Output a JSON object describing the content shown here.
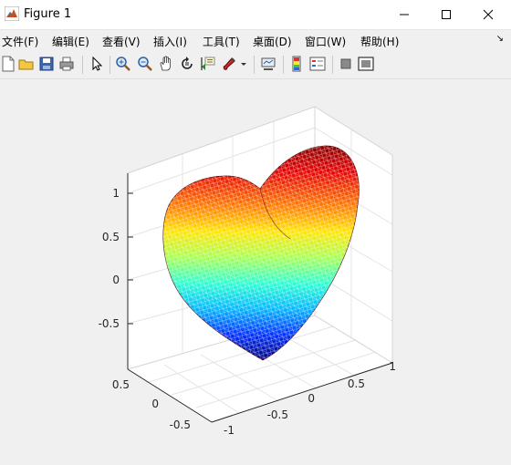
{
  "window": {
    "title": "Figure 1"
  },
  "menu": {
    "items": [
      "文件(F)",
      "编辑(E)",
      "查看(V)",
      "插入(I)",
      "工具(T)",
      "桌面(D)",
      "窗口(W)",
      "帮助(H)"
    ]
  },
  "toolbar": {
    "buttons": [
      "new-figure-icon",
      "open-file-icon",
      "save-icon",
      "print-icon",
      "pointer-icon",
      "zoom-in-icon",
      "zoom-out-icon",
      "pan-hand-icon",
      "rotate-3d-icon",
      "data-cursor-icon",
      "brush-icon",
      "brush-dropdown-icon",
      "link-plot-icon",
      "colorbar-icon",
      "legend-icon",
      "hide-plot-tools-icon",
      "show-plot-tools-icon"
    ]
  },
  "chart_data": {
    "type": "surface-3d",
    "description_shape": "heart",
    "colormap": "jet",
    "render": "wireframe-mesh",
    "z_axis": {
      "ticks": [
        "-0.5",
        "0",
        "0.5",
        "1"
      ],
      "range": [
        -1,
        1.2
      ]
    },
    "y_axis": {
      "ticks": [
        "-0.5",
        "0",
        "0.5"
      ],
      "range": [
        -0.7,
        0.7
      ]
    },
    "x_axis": {
      "ticks": [
        "-1",
        "-0.5",
        "0",
        "0.5",
        "1"
      ],
      "range": [
        -1.2,
        1.2
      ]
    },
    "grid": true,
    "title": "",
    "xlabel": "",
    "ylabel": "",
    "zlabel": ""
  }
}
